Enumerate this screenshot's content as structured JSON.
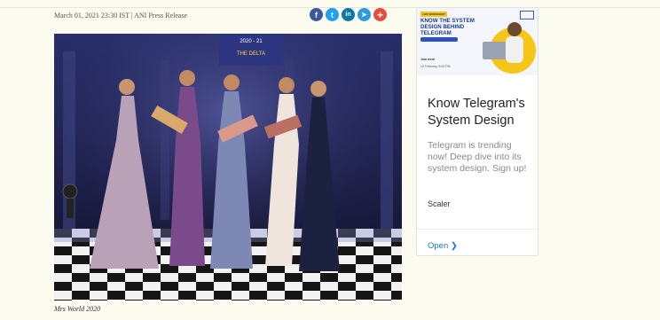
{
  "article": {
    "dateline": "March 01, 2021 23:30 IST | ANI Press Release",
    "photo_caption": "Mrs World 2020",
    "photo_banner": "2020 - 21",
    "photo_banner_sub": "THE DELTA"
  },
  "share": {
    "buttons": [
      {
        "icon": "facebook-icon",
        "glyph": "f",
        "color": "#3b5998"
      },
      {
        "icon": "twitter-icon",
        "glyph": "t",
        "color": "#1da1f2"
      },
      {
        "icon": "linkedin-icon",
        "glyph": "in",
        "color": "#0e76a8"
      },
      {
        "icon": "telegram-icon",
        "glyph": "➤",
        "color": "#2b9be0"
      },
      {
        "icon": "more-icon",
        "glyph": "+",
        "color": "#e84c3d"
      }
    ]
  },
  "ad": {
    "banner_tag": "LIVE WORKSHOP",
    "banner_headline": "KNOW THE SYSTEM DESIGN BEHIND TELEGRAM",
    "banner_cta": "Join now!",
    "banner_cta2": "10 February, 8:00 PM",
    "title": "Know Telegram's System Design",
    "body": "Telegram is trending now! Deep dive into its system design. Sign up!",
    "brand": "Scaler",
    "open_label": "Open",
    "open_icon": "chevron-right-icon"
  }
}
